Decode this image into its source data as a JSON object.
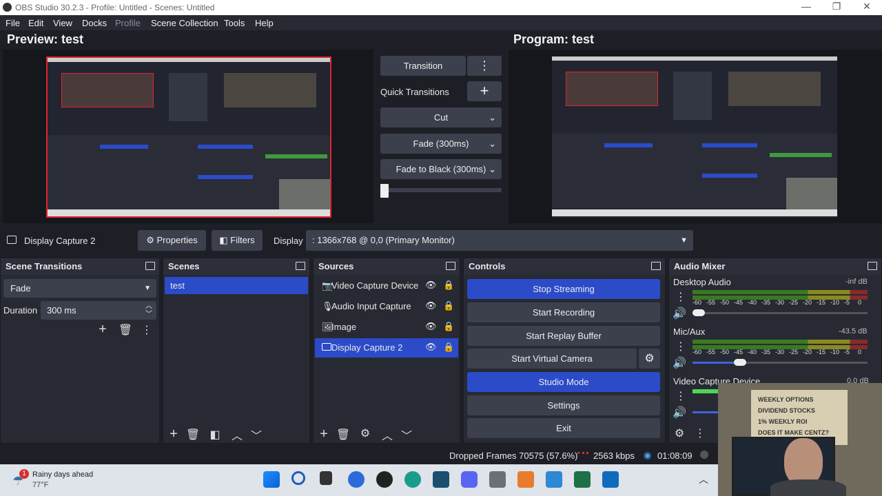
{
  "window": {
    "title": "OBS Studio 30.2.3 - Profile: Untitled - Scenes: Untitled"
  },
  "menu": [
    "File",
    "Edit",
    "View",
    "Docks",
    "Profile",
    "Scene Collection",
    "Tools",
    "Help"
  ],
  "preview": {
    "title": "Preview: test"
  },
  "program": {
    "title": "Program: test"
  },
  "transitions_panel": {
    "transition_label": "Transition",
    "quick_label": "Quick Transitions",
    "cut": "Cut",
    "fade": "Fade (300ms)",
    "fade_black": "Fade to Black (300ms)"
  },
  "source_toolbar": {
    "source_name": "Display Capture 2",
    "properties": "Properties",
    "filters": "Filters",
    "display_label": "Display",
    "display_value": ": 1366x768 @ 0,0 (Primary Monitor)"
  },
  "scene_transitions": {
    "title": "Scene Transitions",
    "type": "Fade",
    "duration_label": "Duration",
    "duration_value": "300 ms"
  },
  "scenes": {
    "title": "Scenes",
    "items": [
      "test"
    ]
  },
  "sources": {
    "title": "Sources",
    "items": [
      {
        "name": "Video Capture Device",
        "icon": "camera-icon"
      },
      {
        "name": "Audio Input Capture",
        "icon": "microphone-icon"
      },
      {
        "name": "Image",
        "icon": "image-icon"
      },
      {
        "name": "Display Capture 2",
        "icon": "monitor-icon"
      }
    ]
  },
  "controls": {
    "title": "Controls",
    "stop_streaming": "Stop Streaming",
    "start_recording": "Start Recording",
    "start_replay": "Start Replay Buffer",
    "start_virtual": "Start Virtual Camera",
    "studio_mode": "Studio Mode",
    "settings": "Settings",
    "exit": "Exit"
  },
  "audio_mixer": {
    "title": "Audio Mixer",
    "channels": [
      {
        "name": "Desktop Audio",
        "level": "-inf dB",
        "volume": 0.06
      },
      {
        "name": "Mic/Aux",
        "level": "-43.5 dB",
        "volume": 0.27
      },
      {
        "name": "Video Capture Device",
        "level": "0.0 dB"
      }
    ],
    "scale": [
      "-60",
      "-55",
      "-50",
      "-45",
      "-40",
      "-35",
      "-30",
      "-25",
      "-20",
      "-15",
      "-10",
      "-5",
      "0"
    ]
  },
  "statusbar": {
    "dropped": "Dropped Frames 70575 (57.6%)",
    "kbps": "2563 kbps",
    "time": "01:08:09"
  },
  "taskbar": {
    "weather": "Rainy days ahead",
    "temp": "77°F",
    "badge": "1"
  },
  "webcam_sign": [
    "WEEKLY OPTIONS",
    "DIVIDEND STOCKS",
    "1% WEEKLY ROI",
    "DOES IT MAKE CENTZ?"
  ],
  "colors": {
    "accent_blue": "#2b4bc9",
    "bg": "#1e1f26",
    "panel": "#272a33",
    "red_border": "#e0242e"
  }
}
